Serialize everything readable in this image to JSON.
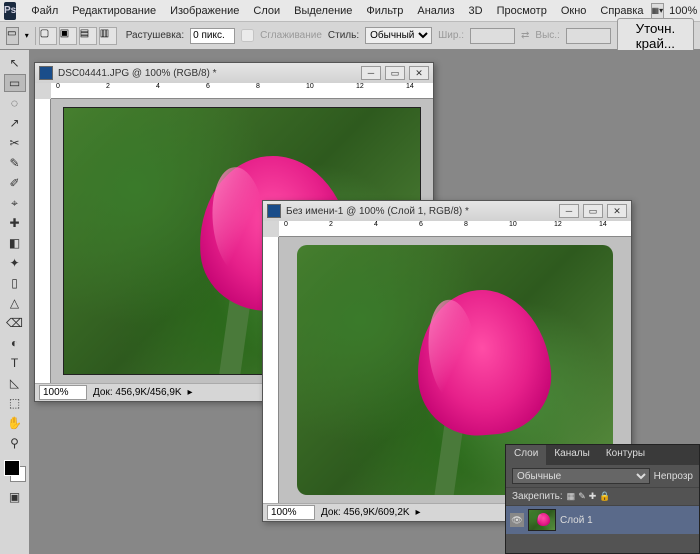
{
  "menu": {
    "items": [
      "Файл",
      "Редактирование",
      "Изображение",
      "Слои",
      "Выделение",
      "Фильтр",
      "Анализ",
      "3D",
      "Просмотр",
      "Окно",
      "Справка"
    ],
    "zoom": "100%"
  },
  "options": {
    "feather_label": "Растушевка:",
    "feather_value": "0 пикс.",
    "antialias": "Сглаживание",
    "style_label": "Стиль:",
    "style_value": "Обычный",
    "width_label": "Шир.:",
    "height_label": "Выс.:",
    "refine": "Уточн. край..."
  },
  "tools": [
    "↖",
    "▭",
    "◌",
    "↗",
    "✂",
    "✎",
    "✐",
    "⌖",
    "✚",
    "◧",
    "✦",
    "▯",
    "△",
    "⌫",
    "◐",
    "✎",
    "T",
    "◺",
    "⬚",
    "✋",
    "⚲",
    "⬛"
  ],
  "doc1": {
    "title": "DSC04441.JPG @ 100% (RGB/8) *",
    "zoom": "100%",
    "docinfo": "Док: 456,9K/456,9K",
    "ruler_marks": [
      "0",
      "2",
      "4",
      "6",
      "8",
      "10",
      "12",
      "14"
    ]
  },
  "doc2": {
    "title": "Без имени-1 @ 100% (Слой 1, RGB/8) *",
    "zoom": "100%",
    "docinfo": "Док: 456,9K/609,2K",
    "ruler_marks": [
      "0",
      "2",
      "4",
      "6",
      "8",
      "10",
      "12",
      "14"
    ]
  },
  "layers_panel": {
    "tabs": [
      "Слои",
      "Каналы",
      "Контуры"
    ],
    "blend_mode": "Обычные",
    "opacity_label": "Непрозр",
    "lock_label": "Закрепить:",
    "layer_name": "Слой 1"
  }
}
